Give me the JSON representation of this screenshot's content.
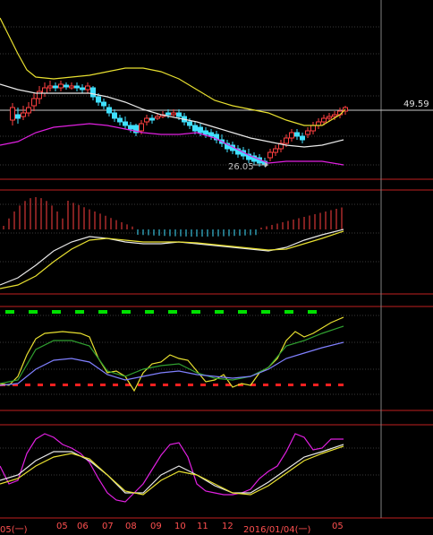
{
  "colors": {
    "background": "#000000",
    "up": "#ff4040",
    "down": "#40e0ff",
    "yellow": "#e8e030",
    "white": "#e8e8e8",
    "magenta": "#e020e0",
    "green": "#00e000",
    "red_dash": "#ff2020",
    "axis": "#c02020",
    "grid": "#3a3a3a"
  },
  "price_panel": {
    "current_price_label": "49.59",
    "low_marker_label": "26.05"
  },
  "x_axis": {
    "labels": [
      "05(一)",
      "05",
      "06",
      "07",
      "08",
      "09",
      "10",
      "11",
      "12",
      "2016/01/04(一)",
      "05"
    ]
  },
  "chart_data": {
    "type": "candlestick",
    "title": "",
    "panels": [
      "price with bands",
      "MACD",
      "trend indicator",
      "oscillator"
    ],
    "annotations": [
      "49.59",
      "26.05"
    ]
  }
}
